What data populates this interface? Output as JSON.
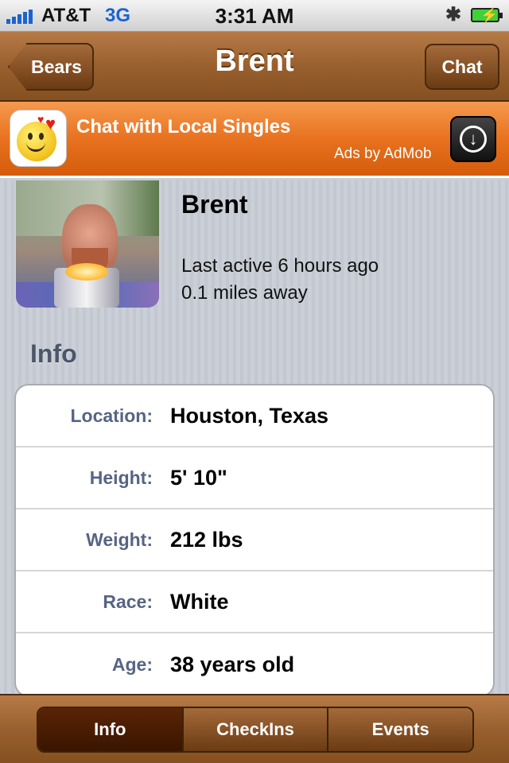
{
  "status_bar": {
    "carrier": "AT&T",
    "network": "3G",
    "time": "3:31 AM",
    "bluetooth_icon": "bluetooth-icon",
    "battery_icon": "battery-charging-icon"
  },
  "nav": {
    "back_label": "Bears",
    "title": "Brent",
    "right_label": "Chat"
  },
  "ad": {
    "title": "Chat with Local Singles",
    "subtitle": "Ads by AdMob",
    "icon": "smiley-hearts-icon",
    "action_icon": "download-icon"
  },
  "profile": {
    "name": "Brent",
    "last_active": "Last active 6 hours ago",
    "distance": "0.1 miles away"
  },
  "info": {
    "section_title": "Info",
    "rows": [
      {
        "label": "Location:",
        "value": "Houston, Texas"
      },
      {
        "label": "Height:",
        "value": "5' 10\""
      },
      {
        "label": "Weight:",
        "value": "212 lbs"
      },
      {
        "label": "Race:",
        "value": "White"
      },
      {
        "label": "Age:",
        "value": "38 years old"
      }
    ]
  },
  "tabs": [
    {
      "label": "Info",
      "active": true
    },
    {
      "label": "CheckIns",
      "active": false
    },
    {
      "label": "Events",
      "active": false
    }
  ],
  "colors": {
    "nav_brown": "#99602f",
    "ad_orange": "#e8721f",
    "label_blue": "#566584"
  }
}
